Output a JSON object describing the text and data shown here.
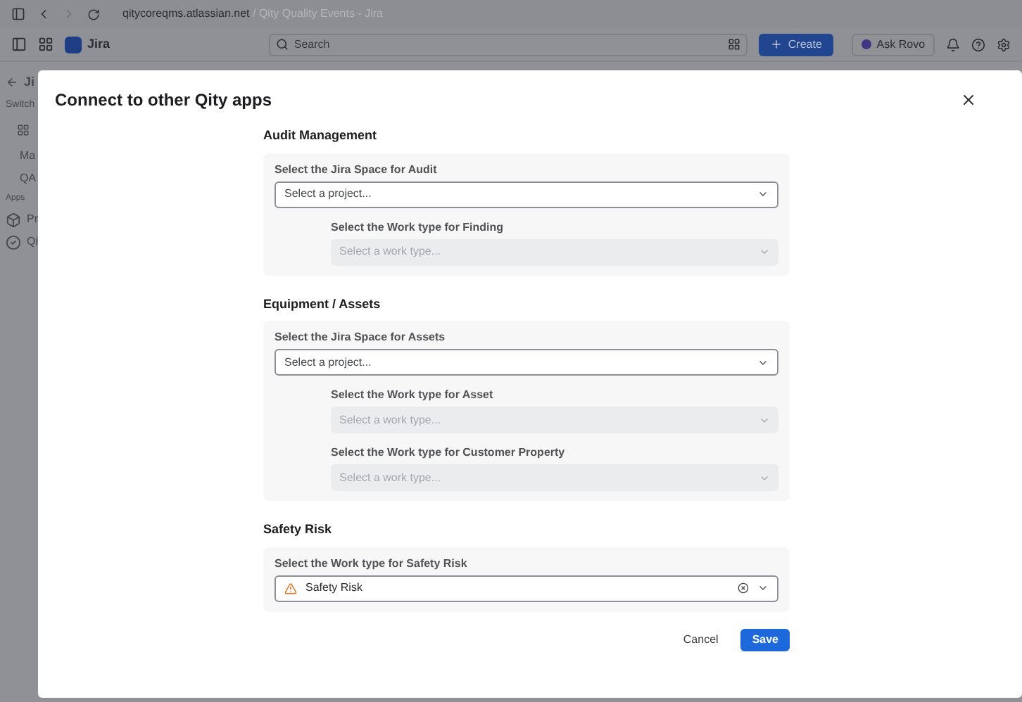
{
  "browser": {
    "host": "qitycoreqms.atlassian.net",
    "page_title": "/ Qity Quality Events - Jira"
  },
  "header": {
    "app_name": "Jira",
    "search": {
      "placeholder": "Search"
    },
    "create": "Create",
    "ask": "Ask Rovo"
  },
  "sidebar": {
    "back": "Ji",
    "switch": "Switch",
    "items": [
      {
        "label": "Ma",
        "kind": "plain"
      },
      {
        "label": "QA",
        "kind": "plain"
      },
      {
        "label": "Apps",
        "kind": "heading"
      },
      {
        "label": "Pr",
        "kind": "box"
      },
      {
        "label": "Qi",
        "kind": "check"
      }
    ]
  },
  "dialog": {
    "title": "Connect to other Qity apps",
    "sections": [
      {
        "heading": "Audit Management",
        "fields": [
          {
            "label": "Select the Jira Space for Audit",
            "placeholder": "Select a project...",
            "indented": false,
            "disabled": false
          },
          {
            "label": "Select the Work type for Finding",
            "placeholder": "Select a work type...",
            "indented": true,
            "disabled": true
          }
        ]
      },
      {
        "heading": "Equipment / Assets",
        "fields": [
          {
            "label": "Select the Jira Space for Assets",
            "placeholder": "Select a project...",
            "indented": false,
            "disabled": false
          },
          {
            "label": "Select the Work type for Asset",
            "placeholder": "Select a work type...",
            "indented": true,
            "disabled": true
          },
          {
            "label": "Select the Work type for Customer Property",
            "placeholder": "Select a work type...",
            "indented": true,
            "disabled": true
          }
        ]
      },
      {
        "heading": "Safety Risk",
        "fields": [
          {
            "label": "Select the Work type for Safety Risk",
            "value": "Safety Risk",
            "indented": false,
            "disabled": false
          }
        ]
      }
    ],
    "cancel": "Cancel",
    "save": "Save"
  }
}
